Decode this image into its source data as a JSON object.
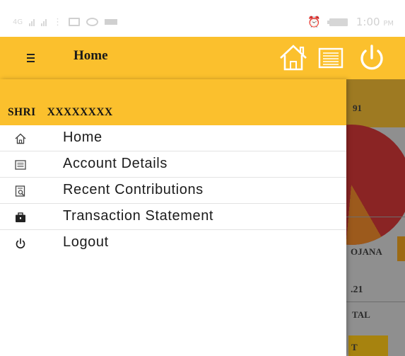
{
  "status_bar": {
    "network": "4G",
    "time": "1:00",
    "time_suffix": "PM"
  },
  "app_bar": {
    "title": "Home",
    "menu_icon": "hamburger-menu-icon",
    "actions": [
      "home-icon",
      "document-icon",
      "power-icon"
    ]
  },
  "drawer": {
    "user_prefix": "SHRI",
    "user_name": "XXXXXXXX",
    "items": [
      {
        "label": "Home",
        "icon": "home-icon"
      },
      {
        "label": "Account Details",
        "icon": "document-icon"
      },
      {
        "label": "Recent Contributions",
        "icon": "search-document-icon"
      },
      {
        "label": "Transaction Statement",
        "icon": "briefcase-icon"
      },
      {
        "label": "Logout",
        "icon": "power-icon"
      }
    ]
  },
  "background": {
    "header_fragment": "91",
    "scheme_fragment": "OJANA",
    "amount_fragment": ".21",
    "total_fragment": "TAL",
    "button_fragment": "T"
  },
  "colors": {
    "accent": "#fbc02d",
    "scrim": "#8f8f8f",
    "text": "#1c1c1c"
  }
}
